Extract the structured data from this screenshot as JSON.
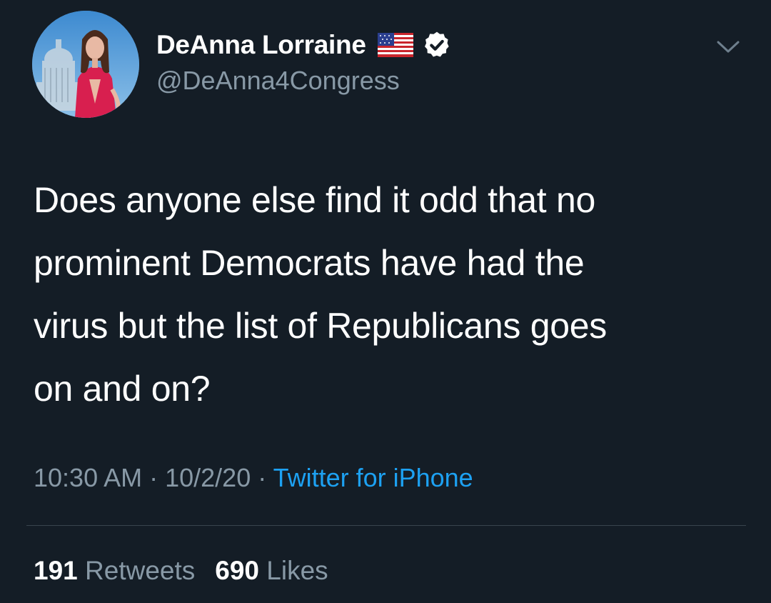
{
  "author": {
    "display_name": "DeAnna Lorraine",
    "handle": "@DeAnna4Congress",
    "avatar_icon": "profile-photo",
    "badges": [
      "us-flag-icon",
      "verified-icon"
    ]
  },
  "tweet": {
    "lines": [
      "Does anyone else find it odd that no",
      "prominent Democrats have had the",
      "virus but the list of Republicans goes",
      "on and on?"
    ]
  },
  "meta": {
    "time": "10:30 AM",
    "separator": " · ",
    "date": "10/2/20",
    "source": "Twitter for iPhone"
  },
  "stats": {
    "retweets_count": "191",
    "retweets_label": "Retweets",
    "likes_count": "690",
    "likes_label": "Likes"
  },
  "colors": {
    "background": "#141d26",
    "text_primary": "#ffffff",
    "text_secondary": "#8899a6",
    "link": "#1da1f2",
    "divider": "#38444d"
  }
}
